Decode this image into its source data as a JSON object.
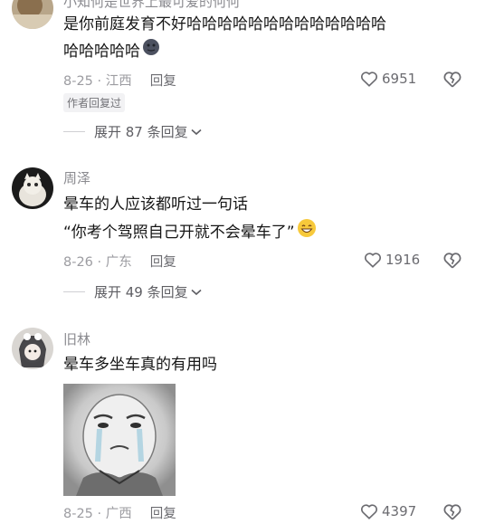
{
  "comments": [
    {
      "username": "小知何是世界上最可爱的何何",
      "lines": [
        "是你前庭发育不好哈哈哈哈哈哈哈哈哈哈哈哈哈",
        "哈哈哈哈哈"
      ],
      "date_location": "8-25 · 江西",
      "reply_label": "回复",
      "likes": "6951",
      "author_tag": "作者回复过",
      "expand_label": "展开 87 条回复"
    },
    {
      "username": "周泽",
      "lines": [
        "晕车的人应该都听过一句话",
        "“你考个驾照自己开就不会晕车了”"
      ],
      "date_location": "8-26 · 广东",
      "reply_label": "回复",
      "likes": "1916",
      "expand_label": "展开 49 条回复"
    },
    {
      "username": "旧林",
      "lines": [
        "晕车多坐车真的有用吗"
      ],
      "date_location": "8-25 · 广西",
      "reply_label": "回复",
      "likes": "4397"
    }
  ],
  "icons": {
    "like": "heart-outline-icon",
    "dislike": "broken-heart-icon",
    "expand": "chevron-down-icon"
  }
}
